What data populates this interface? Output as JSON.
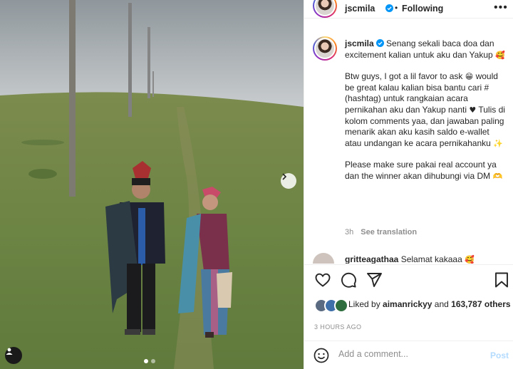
{
  "post": {
    "author": "jscmila",
    "follow_state": "Following",
    "more_icon": "more-dots-icon",
    "caption_lines": [
      "Senang sekali baca doa dan excitement kalian untuk aku dan Yakup",
      "Btw guys, I got a lil favor to ask",
      "would be great kalau kalian bisa bantu cari # (hashtag) untuk rangkaian acara pernikahan aku dan Yakup nanti",
      "Tulis di kolom comments yaa, dan jawaban paling menarik akan aku kasih saldo e-wallet atau undangan ke acara pernikahanku",
      "Please make sure pakai real account ya dan the winner akan dihubungi via DM"
    ],
    "caption_emojis": [
      "🥰",
      "😁",
      "♥",
      "✨",
      "🫶"
    ],
    "caption_age": "3h",
    "see_translation": "See translation",
    "comment_preview": {
      "user": "gritteagathaa",
      "text": "Selamat kakaaa",
      "emoji": "🥰"
    },
    "liked_by": "Liked by",
    "liked_user": "aimanrickyy",
    "likes_and": "and",
    "likes_count": "163,787",
    "likes_suffix": "others",
    "timestamp": "3 HOURS AGO",
    "add_comment_placeholder": "Add a comment...",
    "post_label": "Post"
  },
  "carousel": {
    "total": 2,
    "active": 1
  },
  "colors": {
    "accent": "#0095f6",
    "post_disabled": "#b3dbff",
    "muted": "#8e8e8e"
  }
}
